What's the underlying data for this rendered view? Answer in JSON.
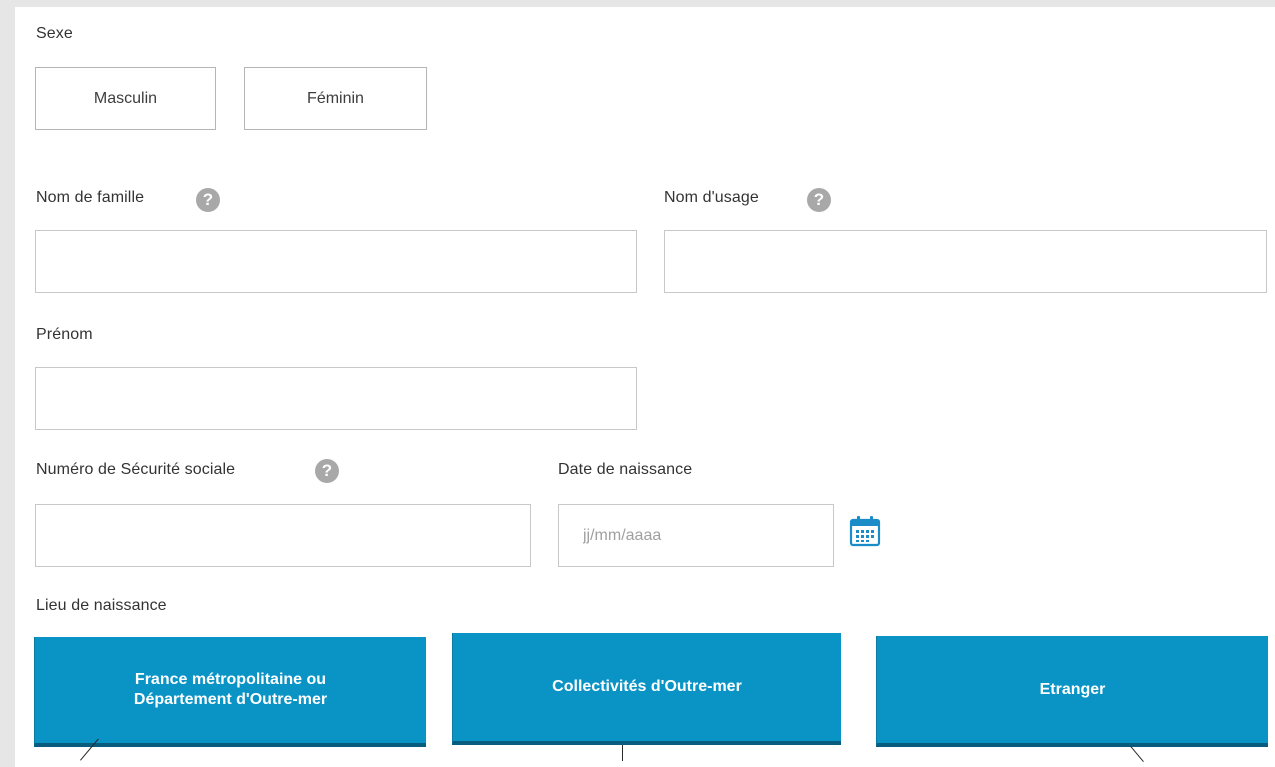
{
  "sexe": {
    "label": "Sexe",
    "options": [
      "Masculin",
      "Féminin"
    ]
  },
  "nom_famille": {
    "label": "Nom de famille",
    "value": "",
    "help_icon": "question-icon"
  },
  "nom_usage": {
    "label": "Nom d'usage",
    "value": "",
    "help_icon": "question-icon"
  },
  "prenom": {
    "label": "Prénom",
    "value": ""
  },
  "securite_sociale": {
    "label": "Numéro de Sécurité sociale",
    "value": "",
    "help_icon": "question-icon"
  },
  "date_naissance": {
    "label": "Date de naissance",
    "placeholder": "jj/mm/aaaa",
    "value": "",
    "icon": "calendar-icon"
  },
  "lieu_naissance": {
    "label": "Lieu de naissance",
    "options": [
      "France métropolitaine ou\nDépartement d'Outre-mer",
      "Collectivités d'Outre-mer",
      "Etranger"
    ]
  },
  "colors": {
    "accent": "#0a94c5",
    "accent_dark": "#085d7f",
    "help_icon": "#a8a8a8",
    "border": "#c8c8c8",
    "background": "#e6e6e6"
  }
}
